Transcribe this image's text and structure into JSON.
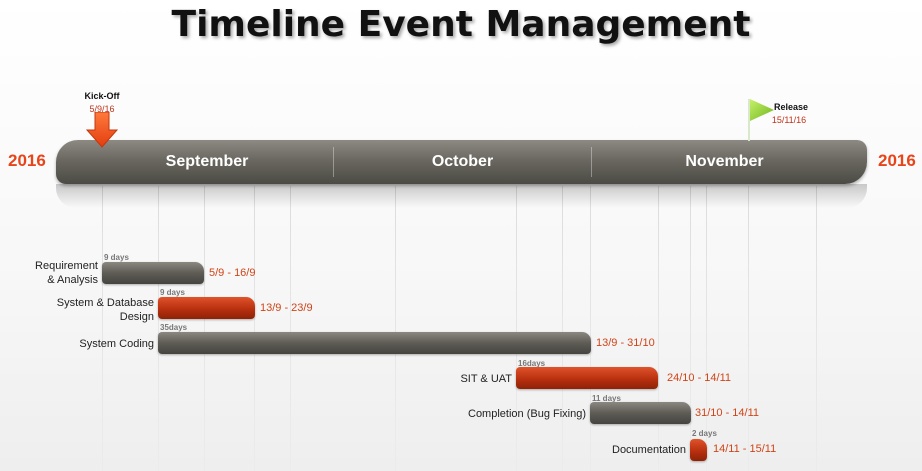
{
  "title": "Timeline Event Management",
  "year_left": "2016",
  "year_right": "2016",
  "months": [
    "September",
    "October",
    "November"
  ],
  "milestones": {
    "kickoff": {
      "label": "Kick-Off",
      "date": "5/9/16",
      "icon": "arrow-down-icon"
    },
    "release": {
      "label": "Release",
      "date": "15/11/16",
      "icon": "flag-icon"
    }
  },
  "tasks": [
    {
      "name": "Requirement\n& Analysis",
      "duration": "9 days",
      "range": "5/9 - 16/9",
      "color": "gray"
    },
    {
      "name": "System & Database\nDesign",
      "duration": "9 days",
      "range": "13/9 - 23/9",
      "color": "red"
    },
    {
      "name": "System Coding",
      "duration": "35days",
      "range": "13/9 - 31/10",
      "color": "gray"
    },
    {
      "name": "SIT & UAT",
      "duration": "16days",
      "range": "24/10 - 14/11",
      "color": "red"
    },
    {
      "name": "Completion (Bug Fixing)",
      "duration": "11 days",
      "range": "31/10 - 14/11",
      "color": "gray"
    },
    {
      "name": "Documentation",
      "duration": "2 days",
      "range": "14/11 - 15/11",
      "color": "red"
    }
  ],
  "colors": {
    "accent": "#e8441a",
    "bar_gray": "#5e5c55",
    "bar_red": "#b8300f",
    "date_text": "#d04417"
  }
}
